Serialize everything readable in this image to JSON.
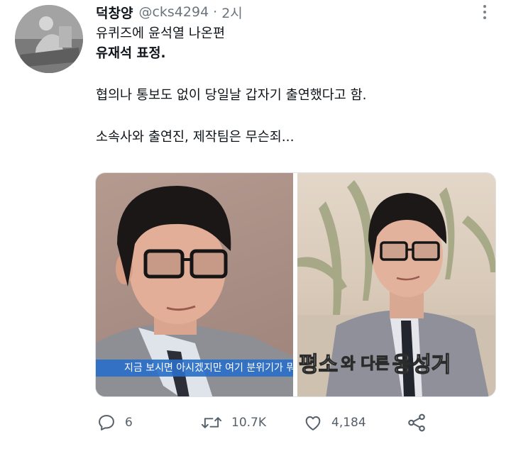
{
  "user": {
    "name": "덕창양",
    "handle": "@cks4294",
    "separator": "·",
    "time": "2시"
  },
  "tweet": {
    "line1": "유퀴즈에 윤석열 나온편",
    "line2": "유재석 표정.",
    "line3": "협의나 통보도 없이 당일날 갑자기 출연했다고 함.",
    "line4": "소속사와 출연진, 제작팀은 무슨죄..."
  },
  "media": {
    "image1_caption": "지금 보시면 아시겠지만 여기 분위기가 뭐",
    "image2_caption_a": "평소",
    "image2_caption_b": "와 다른",
    "image2_caption_c": "웅성거"
  },
  "actions": {
    "reply_count": "6",
    "retweet_count": "10.7K",
    "like_count": "4,184"
  },
  "icons": {
    "more": "more-vertical-icon",
    "reply": "reply-icon",
    "retweet": "retweet-icon",
    "like": "heart-icon",
    "share": "share-icon"
  },
  "colors": {
    "text": "#0f1419",
    "secondary": "#6b747c",
    "icon": "#56606a",
    "caption_bar": "#286ec8"
  }
}
